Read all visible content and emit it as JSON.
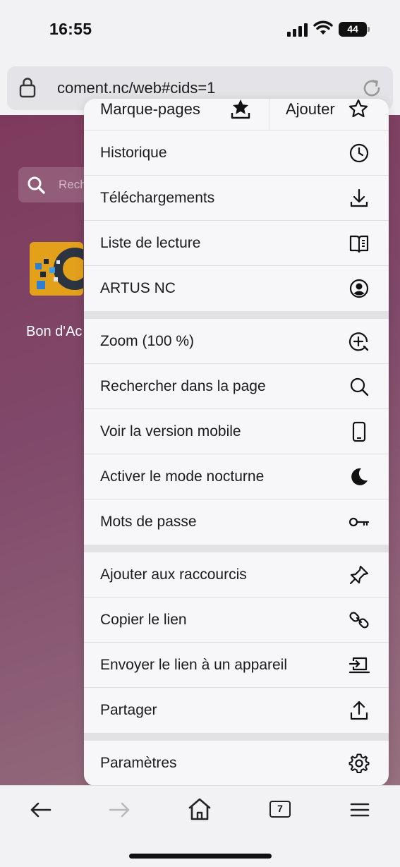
{
  "status": {
    "time": "16:55",
    "battery": "44"
  },
  "urlbar": {
    "url": "coment.nc/web#cids=1"
  },
  "page": {
    "search_placeholder": "Rech",
    "app_label": "Bon d'Ac"
  },
  "menu": {
    "top": {
      "bookmarks_label": "Marque-pages",
      "add_label": "Ajouter"
    },
    "items": [
      {
        "label": "Historique",
        "icon": "clock-icon"
      },
      {
        "label": "Téléchargements",
        "icon": "download-icon"
      },
      {
        "label": "Liste de lecture",
        "icon": "reading-list-icon"
      },
      {
        "label": "ARTUS NC",
        "icon": "account-icon"
      },
      {
        "label": "Zoom (100 %)",
        "icon": "zoom-in-icon"
      },
      {
        "label": "Rechercher dans la page",
        "icon": "search-icon"
      },
      {
        "label": "Voir la version mobile",
        "icon": "phone-icon"
      },
      {
        "label": "Activer le mode nocturne",
        "icon": "moon-icon"
      },
      {
        "label": "Mots de passe",
        "icon": "key-icon"
      },
      {
        "label": "Ajouter aux raccourcis",
        "icon": "pin-icon"
      },
      {
        "label": "Copier le lien",
        "icon": "link-icon"
      },
      {
        "label": "Envoyer le lien à un appareil",
        "icon": "send-to-device-icon"
      },
      {
        "label": "Partager",
        "icon": "share-icon"
      },
      {
        "label": "Paramètres",
        "icon": "gear-icon"
      }
    ]
  },
  "toolbar": {
    "tab_count": "7"
  }
}
